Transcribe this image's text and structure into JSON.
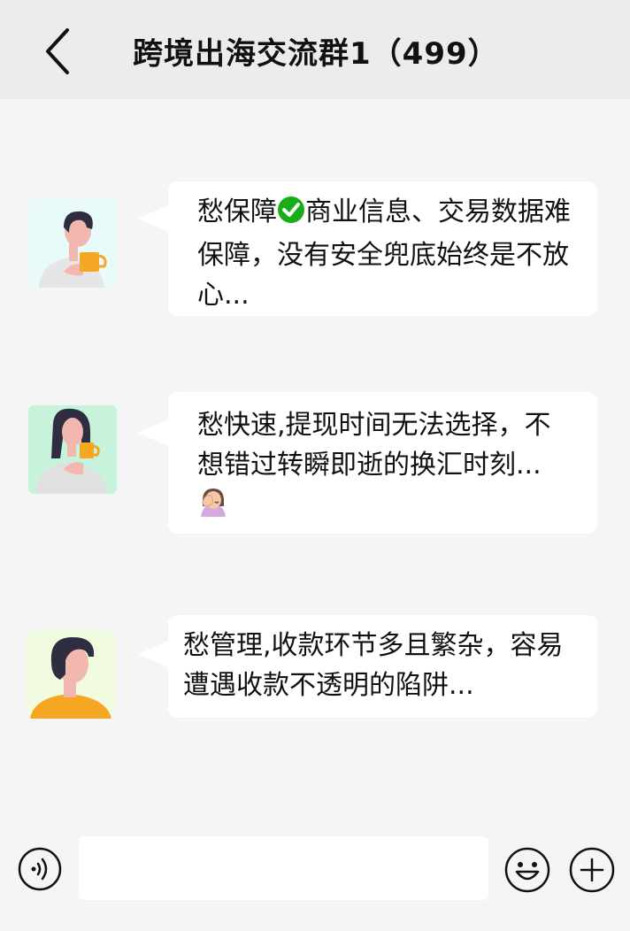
{
  "header": {
    "title": "跨境出海交流群1（499）",
    "back_icon": "chevron-left-icon"
  },
  "messages": [
    {
      "avatar": "avatar-man-holding-mug",
      "text_before": "愁保障",
      "inline_icon": "check-circle-icon",
      "text_after": "商业信息、交易数据难保障，没有安全兜底始终是不放心..."
    },
    {
      "avatar": "avatar-woman-holding-mug",
      "text_before": "愁快速,提现时间无法选择，不想错过转瞬即逝的换汇时刻...",
      "inline_icon": "facepalm-emoji-icon"
    },
    {
      "avatar": "avatar-man-orange-shirt",
      "text_before": "愁管理,收款环节多且繁杂，容易遭遇收款不透明的陷阱..."
    }
  ],
  "input_bar": {
    "voice_icon": "voice-icon",
    "placeholder": "",
    "emoji_icon": "smiley-icon",
    "plus_icon": "plus-circle-icon"
  },
  "colors": {
    "header_bg": "#ececec",
    "page_bg": "#f5f5f5",
    "bubble_bg": "#ffffff",
    "check_green": "#1aad19",
    "mug_orange": "#f5a623"
  }
}
